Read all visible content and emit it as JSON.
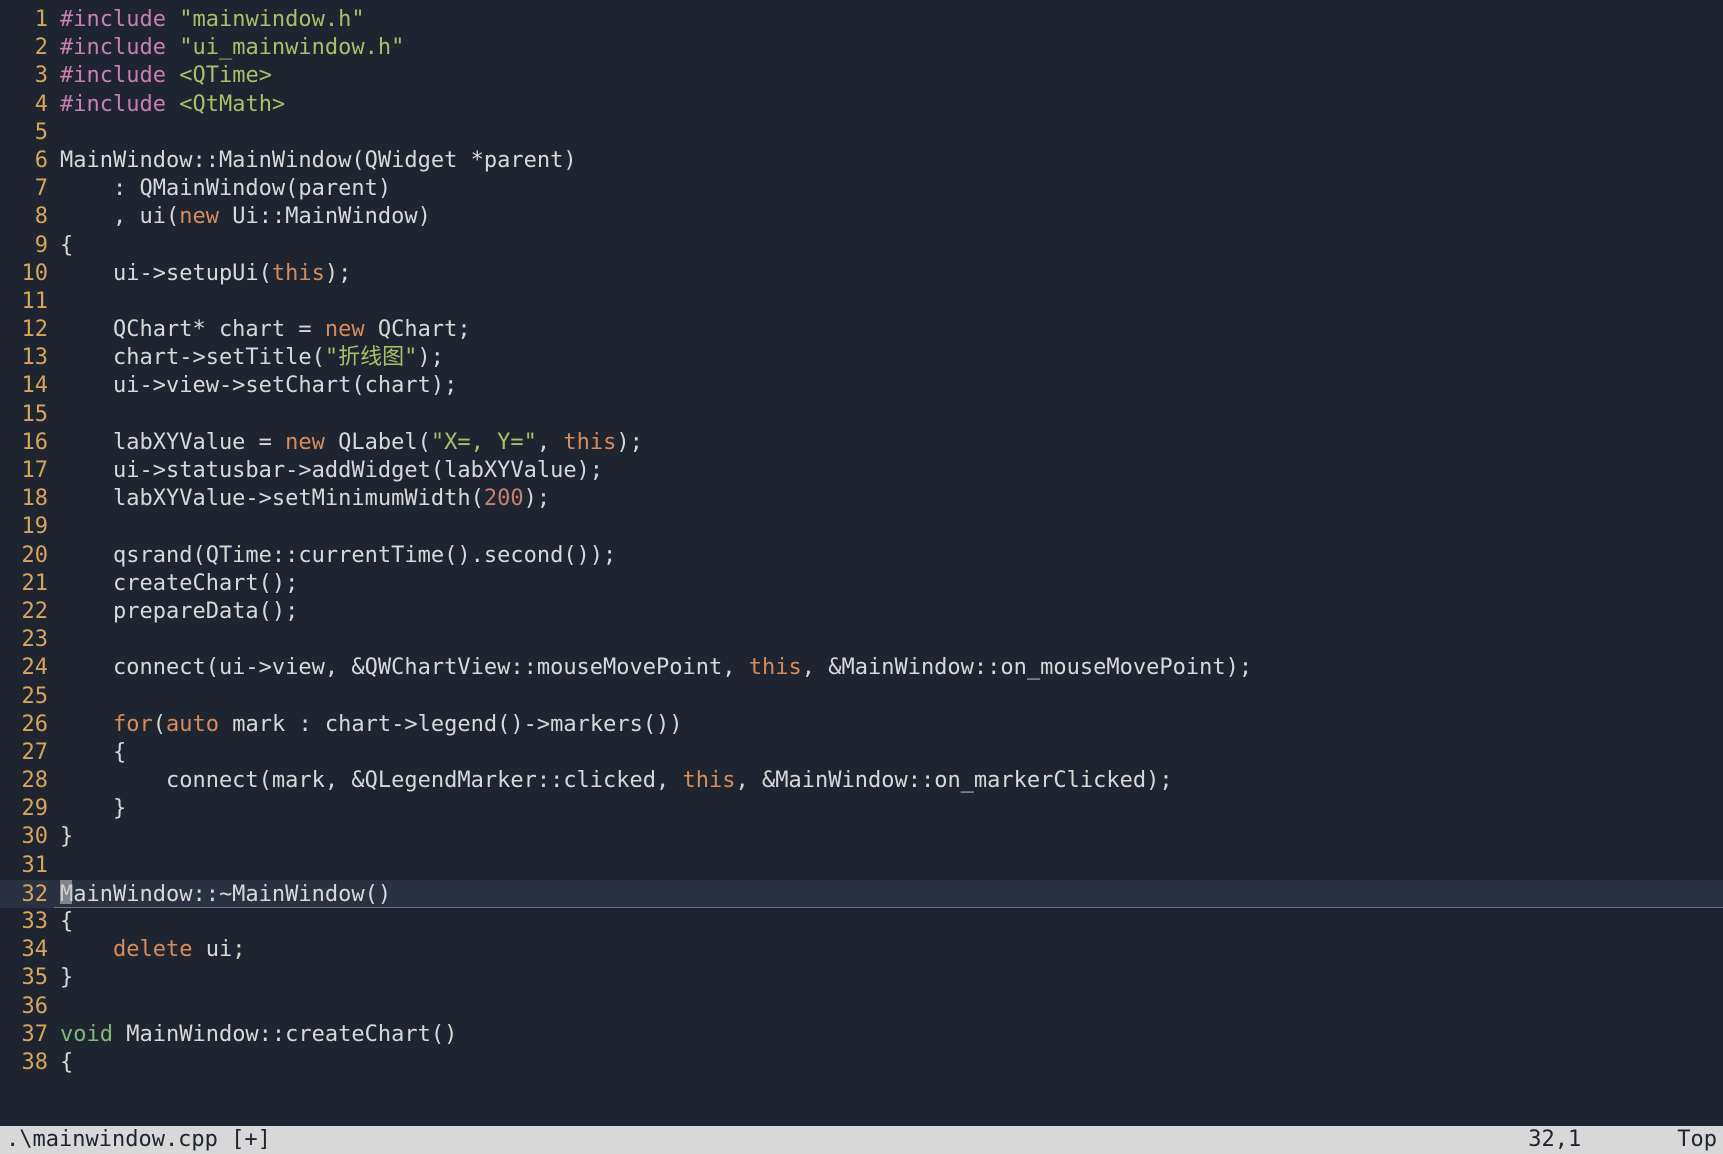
{
  "statusbar": {
    "filename": ".\\mainwindow.cpp [+]",
    "position": "32,1",
    "scroll": "Top"
  },
  "cursor_line": 32,
  "lines": [
    {
      "n": 1,
      "tokens": [
        [
          "pre",
          "#include "
        ],
        [
          "str",
          "\"mainwindow.h\""
        ]
      ]
    },
    {
      "n": 2,
      "tokens": [
        [
          "pre",
          "#include "
        ],
        [
          "str",
          "\"ui_mainwindow.h\""
        ]
      ]
    },
    {
      "n": 3,
      "tokens": [
        [
          "pre",
          "#include "
        ],
        [
          "str",
          "<QTime>"
        ]
      ]
    },
    {
      "n": 4,
      "tokens": [
        [
          "pre",
          "#include "
        ],
        [
          "str",
          "<QtMath>"
        ]
      ]
    },
    {
      "n": 5,
      "tokens": []
    },
    {
      "n": 6,
      "tokens": [
        [
          "id",
          "MainWindow::MainWindow(QWidget *parent)"
        ]
      ]
    },
    {
      "n": 7,
      "tokens": [
        [
          "id",
          "    : QMainWindow(parent)"
        ]
      ]
    },
    {
      "n": 8,
      "tokens": [
        [
          "id",
          "    , ui("
        ],
        [
          "kw",
          "new"
        ],
        [
          "id",
          " Ui::MainWindow)"
        ]
      ]
    },
    {
      "n": 9,
      "tokens": [
        [
          "id",
          "{"
        ]
      ]
    },
    {
      "n": 10,
      "tokens": [
        [
          "id",
          "    ui->setupUi("
        ],
        [
          "kw",
          "this"
        ],
        [
          "id",
          ");"
        ]
      ]
    },
    {
      "n": 11,
      "tokens": []
    },
    {
      "n": 12,
      "tokens": [
        [
          "id",
          "    QChart* chart = "
        ],
        [
          "kw",
          "new"
        ],
        [
          "id",
          " QChart;"
        ]
      ]
    },
    {
      "n": 13,
      "tokens": [
        [
          "id",
          "    chart->setTitle("
        ],
        [
          "str",
          "\"折线图\""
        ],
        [
          "id",
          ");"
        ]
      ]
    },
    {
      "n": 14,
      "tokens": [
        [
          "id",
          "    ui->view->setChart(chart);"
        ]
      ]
    },
    {
      "n": 15,
      "tokens": []
    },
    {
      "n": 16,
      "tokens": [
        [
          "id",
          "    labXYValue = "
        ],
        [
          "kw",
          "new"
        ],
        [
          "id",
          " QLabel("
        ],
        [
          "str",
          "\"X=, Y=\""
        ],
        [
          "id",
          ", "
        ],
        [
          "kw",
          "this"
        ],
        [
          "id",
          ");"
        ]
      ]
    },
    {
      "n": 17,
      "tokens": [
        [
          "id",
          "    ui->statusbar->addWidget(labXYValue);"
        ]
      ]
    },
    {
      "n": 18,
      "tokens": [
        [
          "id",
          "    labXYValue->setMinimumWidth("
        ],
        [
          "num",
          "200"
        ],
        [
          "id",
          ");"
        ]
      ]
    },
    {
      "n": 19,
      "tokens": []
    },
    {
      "n": 20,
      "tokens": [
        [
          "id",
          "    qsrand(QTime::currentTime().second());"
        ]
      ]
    },
    {
      "n": 21,
      "tokens": [
        [
          "id",
          "    createChart();"
        ]
      ]
    },
    {
      "n": 22,
      "tokens": [
        [
          "id",
          "    prepareData();"
        ]
      ]
    },
    {
      "n": 23,
      "tokens": []
    },
    {
      "n": 24,
      "tokens": [
        [
          "id",
          "    connect(ui->view, &QWChartView::mouseMovePoint, "
        ],
        [
          "kw",
          "this"
        ],
        [
          "id",
          ", &MainWindow::on_mouseMovePoint);"
        ]
      ]
    },
    {
      "n": 25,
      "tokens": []
    },
    {
      "n": 26,
      "tokens": [
        [
          "id",
          "    "
        ],
        [
          "kw",
          "for"
        ],
        [
          "id",
          "("
        ],
        [
          "kw",
          "auto"
        ],
        [
          "id",
          " mark : chart->legend()->markers())"
        ]
      ]
    },
    {
      "n": 27,
      "tokens": [
        [
          "id",
          "    {"
        ]
      ]
    },
    {
      "n": 28,
      "tokens": [
        [
          "id",
          "        connect(mark, &QLegendMarker::clicked, "
        ],
        [
          "kw",
          "this"
        ],
        [
          "id",
          ", &MainWindow::on_markerClicked);"
        ]
      ]
    },
    {
      "n": 29,
      "tokens": [
        [
          "id",
          "    }"
        ]
      ]
    },
    {
      "n": 30,
      "tokens": [
        [
          "id",
          "}"
        ]
      ]
    },
    {
      "n": 31,
      "tokens": []
    },
    {
      "n": 32,
      "tokens": [
        [
          "id",
          "MainWindow::~MainWindow()"
        ]
      ]
    },
    {
      "n": 33,
      "tokens": [
        [
          "id",
          "{"
        ]
      ]
    },
    {
      "n": 34,
      "tokens": [
        [
          "id",
          "    "
        ],
        [
          "kw",
          "delete"
        ],
        [
          "id",
          " ui;"
        ]
      ]
    },
    {
      "n": 35,
      "tokens": [
        [
          "id",
          "}"
        ]
      ]
    },
    {
      "n": 36,
      "tokens": []
    },
    {
      "n": 37,
      "tokens": [
        [
          "type",
          "void"
        ],
        [
          "id",
          " MainWindow::createChart()"
        ]
      ]
    },
    {
      "n": 38,
      "tokens": [
        [
          "id",
          "{"
        ]
      ]
    }
  ]
}
